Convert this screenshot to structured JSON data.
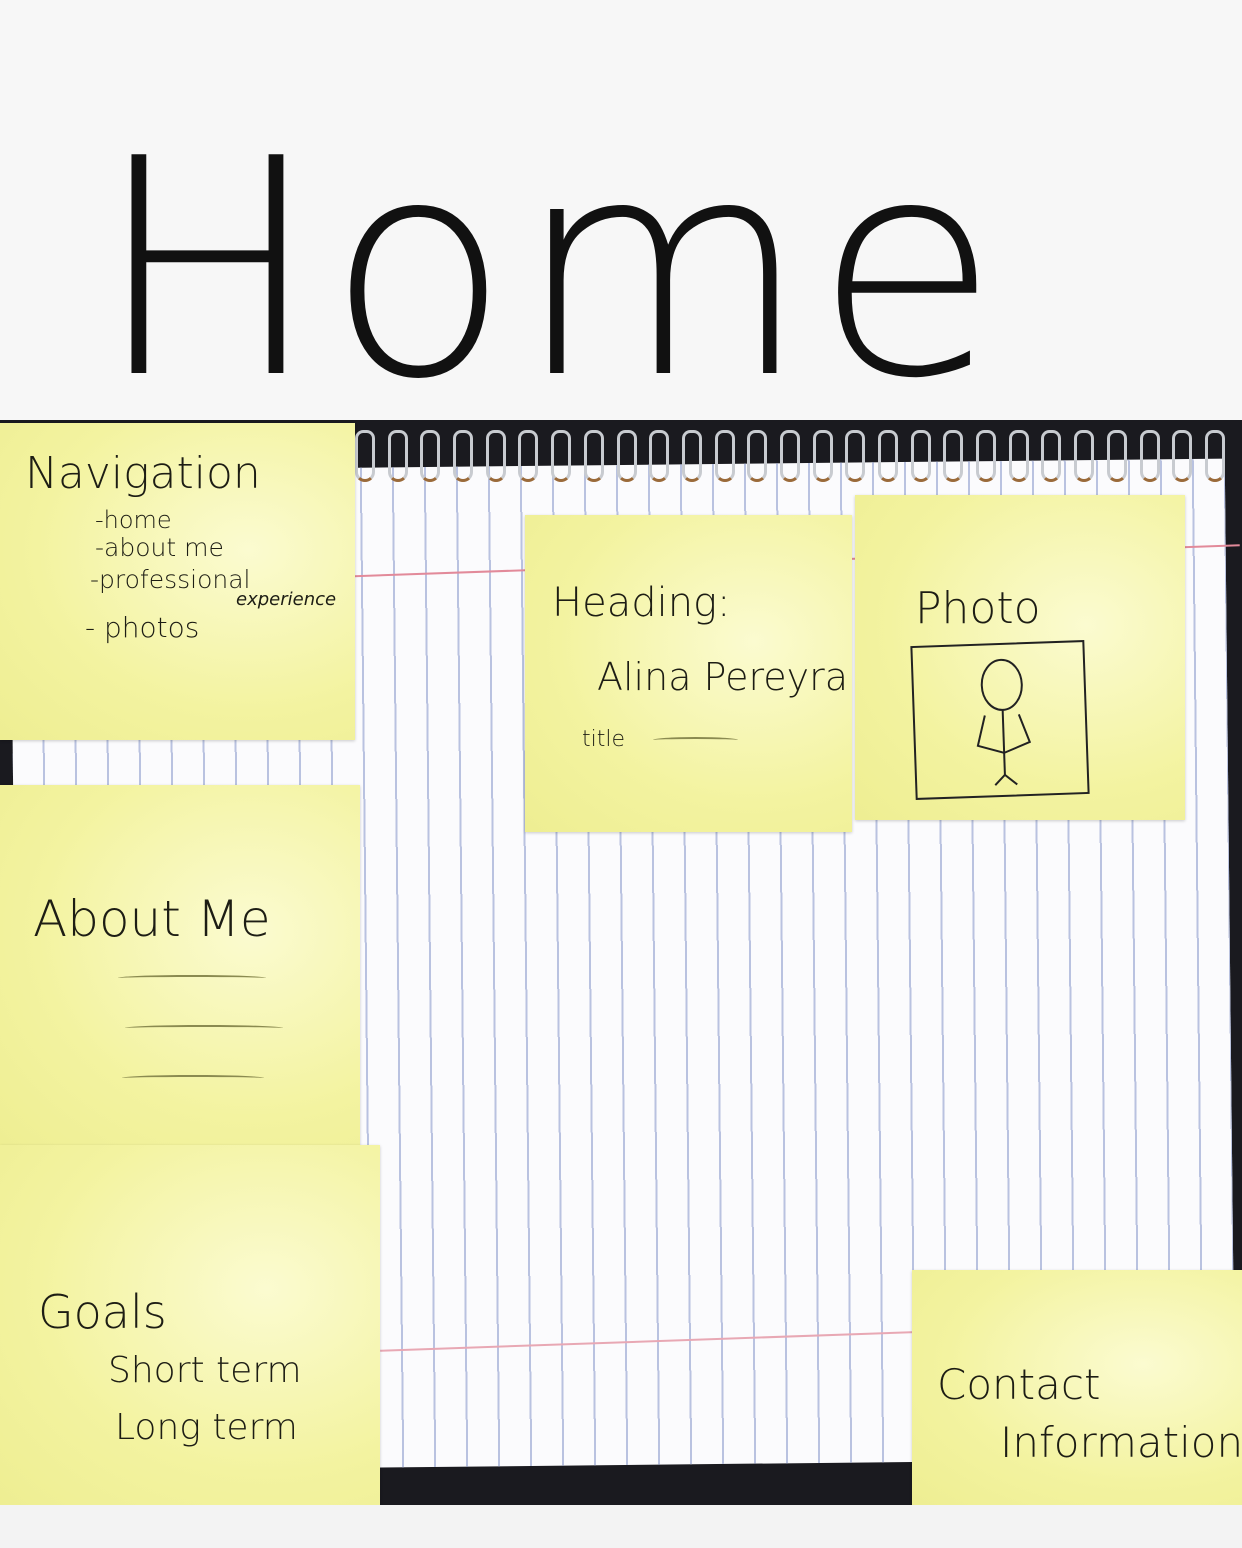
{
  "page_title": "Home",
  "notes": {
    "navigation": {
      "title": "Navigation",
      "items": [
        "-home",
        "-about me",
        "-professional",
        "experience",
        "- photos"
      ]
    },
    "heading": {
      "title": "Heading:",
      "name": "Alina Pereyra",
      "subtitle": "title"
    },
    "photo": {
      "title": "Photo"
    },
    "about": {
      "title": "About Me"
    },
    "goals": {
      "title": "Goals",
      "items": [
        "Short term",
        "Long term"
      ]
    },
    "contact": {
      "title": "Contact",
      "subtitle": "Information"
    }
  }
}
